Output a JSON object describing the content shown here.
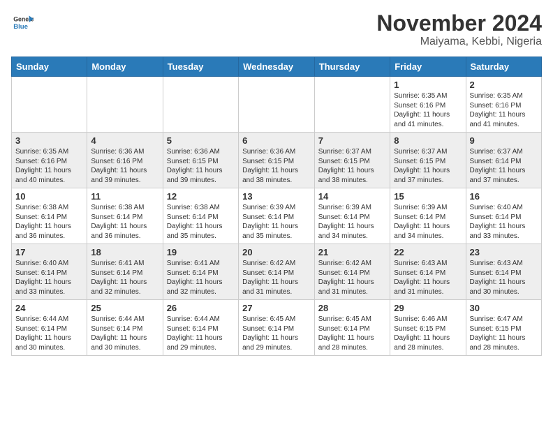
{
  "header": {
    "logo_line1": "General",
    "logo_line2": "Blue",
    "title": "November 2024",
    "subtitle": "Maiyama, Kebbi, Nigeria"
  },
  "weekdays": [
    "Sunday",
    "Monday",
    "Tuesday",
    "Wednesday",
    "Thursday",
    "Friday",
    "Saturday"
  ],
  "weeks": [
    [
      {
        "day": "",
        "info": ""
      },
      {
        "day": "",
        "info": ""
      },
      {
        "day": "",
        "info": ""
      },
      {
        "day": "",
        "info": ""
      },
      {
        "day": "",
        "info": ""
      },
      {
        "day": "1",
        "info": "Sunrise: 6:35 AM\nSunset: 6:16 PM\nDaylight: 11 hours and 41 minutes."
      },
      {
        "day": "2",
        "info": "Sunrise: 6:35 AM\nSunset: 6:16 PM\nDaylight: 11 hours and 41 minutes."
      }
    ],
    [
      {
        "day": "3",
        "info": "Sunrise: 6:35 AM\nSunset: 6:16 PM\nDaylight: 11 hours and 40 minutes."
      },
      {
        "day": "4",
        "info": "Sunrise: 6:36 AM\nSunset: 6:16 PM\nDaylight: 11 hours and 39 minutes."
      },
      {
        "day": "5",
        "info": "Sunrise: 6:36 AM\nSunset: 6:15 PM\nDaylight: 11 hours and 39 minutes."
      },
      {
        "day": "6",
        "info": "Sunrise: 6:36 AM\nSunset: 6:15 PM\nDaylight: 11 hours and 38 minutes."
      },
      {
        "day": "7",
        "info": "Sunrise: 6:37 AM\nSunset: 6:15 PM\nDaylight: 11 hours and 38 minutes."
      },
      {
        "day": "8",
        "info": "Sunrise: 6:37 AM\nSunset: 6:15 PM\nDaylight: 11 hours and 37 minutes."
      },
      {
        "day": "9",
        "info": "Sunrise: 6:37 AM\nSunset: 6:14 PM\nDaylight: 11 hours and 37 minutes."
      }
    ],
    [
      {
        "day": "10",
        "info": "Sunrise: 6:38 AM\nSunset: 6:14 PM\nDaylight: 11 hours and 36 minutes."
      },
      {
        "day": "11",
        "info": "Sunrise: 6:38 AM\nSunset: 6:14 PM\nDaylight: 11 hours and 36 minutes."
      },
      {
        "day": "12",
        "info": "Sunrise: 6:38 AM\nSunset: 6:14 PM\nDaylight: 11 hours and 35 minutes."
      },
      {
        "day": "13",
        "info": "Sunrise: 6:39 AM\nSunset: 6:14 PM\nDaylight: 11 hours and 35 minutes."
      },
      {
        "day": "14",
        "info": "Sunrise: 6:39 AM\nSunset: 6:14 PM\nDaylight: 11 hours and 34 minutes."
      },
      {
        "day": "15",
        "info": "Sunrise: 6:39 AM\nSunset: 6:14 PM\nDaylight: 11 hours and 34 minutes."
      },
      {
        "day": "16",
        "info": "Sunrise: 6:40 AM\nSunset: 6:14 PM\nDaylight: 11 hours and 33 minutes."
      }
    ],
    [
      {
        "day": "17",
        "info": "Sunrise: 6:40 AM\nSunset: 6:14 PM\nDaylight: 11 hours and 33 minutes."
      },
      {
        "day": "18",
        "info": "Sunrise: 6:41 AM\nSunset: 6:14 PM\nDaylight: 11 hours and 32 minutes."
      },
      {
        "day": "19",
        "info": "Sunrise: 6:41 AM\nSunset: 6:14 PM\nDaylight: 11 hours and 32 minutes."
      },
      {
        "day": "20",
        "info": "Sunrise: 6:42 AM\nSunset: 6:14 PM\nDaylight: 11 hours and 31 minutes."
      },
      {
        "day": "21",
        "info": "Sunrise: 6:42 AM\nSunset: 6:14 PM\nDaylight: 11 hours and 31 minutes."
      },
      {
        "day": "22",
        "info": "Sunrise: 6:43 AM\nSunset: 6:14 PM\nDaylight: 11 hours and 31 minutes."
      },
      {
        "day": "23",
        "info": "Sunrise: 6:43 AM\nSunset: 6:14 PM\nDaylight: 11 hours and 30 minutes."
      }
    ],
    [
      {
        "day": "24",
        "info": "Sunrise: 6:44 AM\nSunset: 6:14 PM\nDaylight: 11 hours and 30 minutes."
      },
      {
        "day": "25",
        "info": "Sunrise: 6:44 AM\nSunset: 6:14 PM\nDaylight: 11 hours and 30 minutes."
      },
      {
        "day": "26",
        "info": "Sunrise: 6:44 AM\nSunset: 6:14 PM\nDaylight: 11 hours and 29 minutes."
      },
      {
        "day": "27",
        "info": "Sunrise: 6:45 AM\nSunset: 6:14 PM\nDaylight: 11 hours and 29 minutes."
      },
      {
        "day": "28",
        "info": "Sunrise: 6:45 AM\nSunset: 6:14 PM\nDaylight: 11 hours and 28 minutes."
      },
      {
        "day": "29",
        "info": "Sunrise: 6:46 AM\nSunset: 6:15 PM\nDaylight: 11 hours and 28 minutes."
      },
      {
        "day": "30",
        "info": "Sunrise: 6:47 AM\nSunset: 6:15 PM\nDaylight: 11 hours and 28 minutes."
      }
    ]
  ]
}
